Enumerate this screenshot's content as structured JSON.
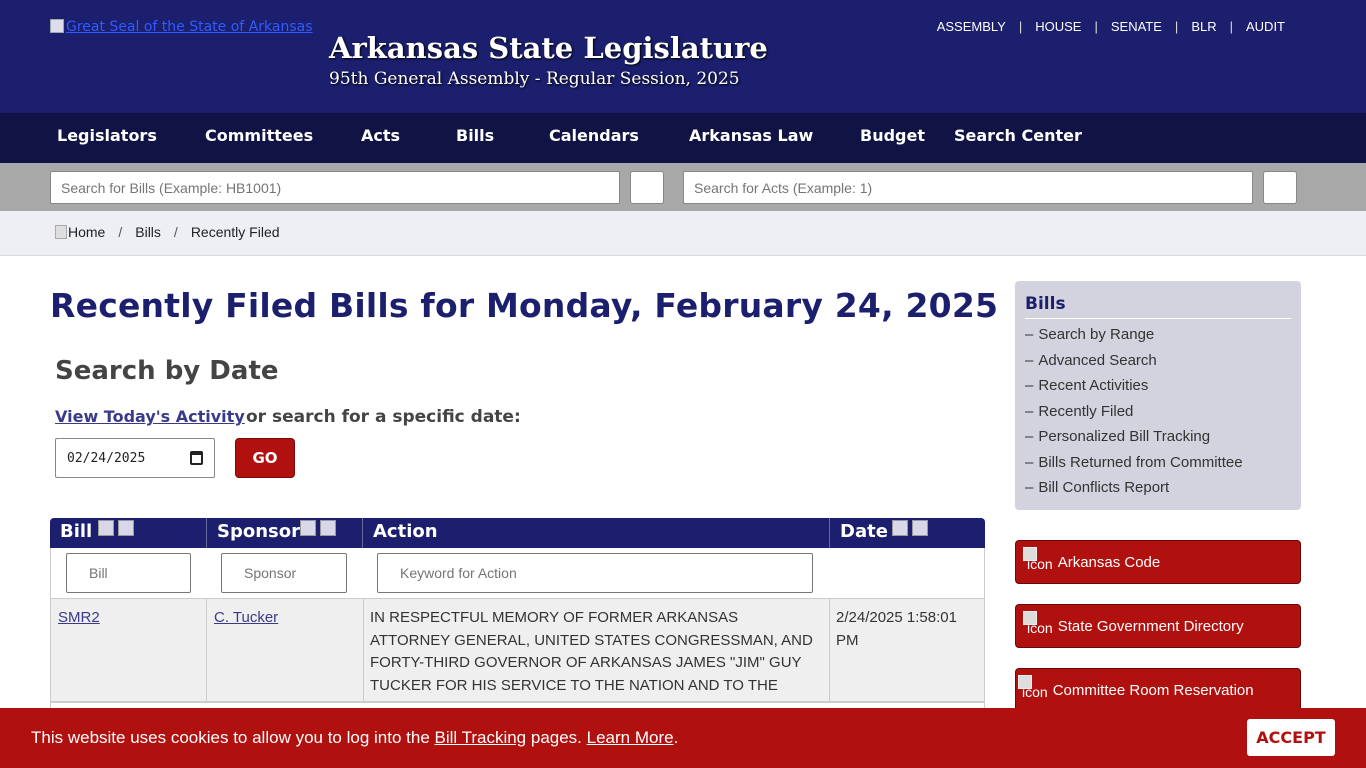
{
  "header": {
    "seal_alt": "Great Seal of the State of Arkansas",
    "title": "Arkansas State Legislature",
    "subtitle": "95th General Assembly - Regular Session, 2025",
    "top_links": [
      "ASSEMBLY",
      "HOUSE",
      "SENATE",
      "BLR",
      "AUDIT"
    ],
    "top_sep": "|"
  },
  "nav": {
    "items": [
      "Legislators",
      "Committees",
      "Acts",
      "Bills",
      "Calendars",
      "Arkansas Law",
      "Budget",
      "Search Center"
    ]
  },
  "search": {
    "bills_placeholder": "Search for Bills (Example: HB1001)",
    "acts_placeholder": "Search for Acts (Example: 1)"
  },
  "breadcrumb": {
    "home": "Home",
    "bills": "Bills",
    "current": "Recently Filed",
    "sep": "/"
  },
  "main": {
    "page_title": "Recently Filed Bills for Monday, February 24, 2025",
    "search_by_date": "Search by Date",
    "today_link": "View Today's Activity",
    "or_text": "or search for a specific date:",
    "date_value": "02/24/2025",
    "go_label": "GO"
  },
  "table": {
    "headers": {
      "bill": "Bill",
      "sponsor": "Sponsor",
      "action": "Action",
      "date": "Date"
    },
    "filters": {
      "bill": "Bill",
      "sponsor": "Sponsor",
      "action": "Keyword for Action"
    },
    "rows": [
      {
        "bill": "SMR2",
        "sponsor": "C. Tucker",
        "action": "IN RESPECTFUL MEMORY OF FORMER ARKANSAS ATTORNEY GENERAL, UNITED STATES CONGRESSMAN, AND FORTY-THIRD GOVERNOR OF ARKANSAS JAMES \"JIM\" GUY TUCKER FOR HIS SERVICE TO THE NATION AND TO THE STATE OF ARKANSAS.",
        "date": "2/24/2025 1:58:01 PM"
      }
    ]
  },
  "sidebar": {
    "title": "Bills",
    "dash": "–",
    "items": [
      "Search by Range",
      "Advanced Search",
      "Recent Activities",
      "Recently Filed",
      "Personalized Bill Tracking",
      "Bills Returned from Committee",
      "Bill Conflicts Report"
    ],
    "icon_alt": "icon",
    "buttons": [
      "Arkansas Code",
      "State Government Directory",
      "Committee Room Reservation"
    ]
  },
  "cookie": {
    "text_before": "This website uses cookies to allow you to log into the ",
    "link1": "Bill Tracking",
    "text_middle": " pages. ",
    "link2": "Learn More",
    "text_after": ".",
    "accept": "ACCEPT"
  },
  "colors": {
    "header_bg": "#1b1f6e",
    "nav_bg": "#111344",
    "accent_red": "#b0100e",
    "sidebar_bg": "#d2d3de"
  }
}
